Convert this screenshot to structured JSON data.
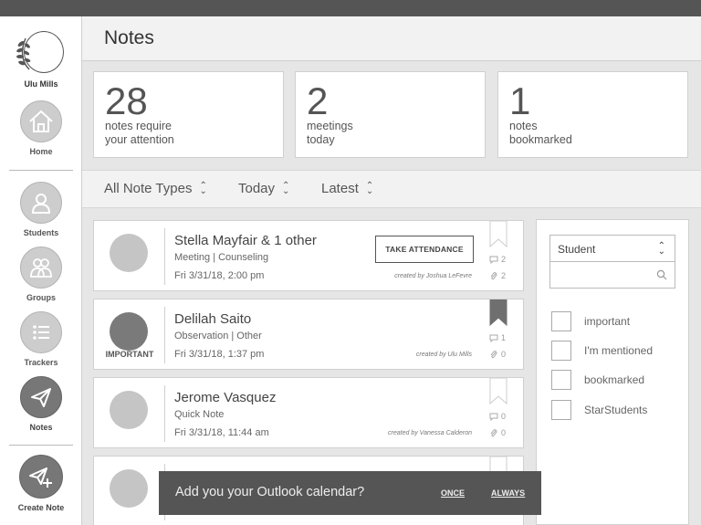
{
  "header": {
    "title": "Notes"
  },
  "sidebar": {
    "brand": "Ulu Mills",
    "items": [
      {
        "label": "Home"
      },
      {
        "label": "Students"
      },
      {
        "label": "Groups"
      },
      {
        "label": "Trackers"
      },
      {
        "label": "Notes"
      },
      {
        "label": "Create Note"
      }
    ]
  },
  "stats": [
    {
      "number": "28",
      "line1": "notes require",
      "line2": "your attention"
    },
    {
      "number": "2",
      "line1": "meetings",
      "line2": "today"
    },
    {
      "number": "1",
      "line1": "notes",
      "line2": "bookmarked"
    }
  ],
  "filters": {
    "type": "All Note Types",
    "date": "Today",
    "sort": "Latest"
  },
  "notes": [
    {
      "name": "Stella Mayfair & 1 other",
      "type": "Meeting | Counseling",
      "date": "Fri 3/31/18, 2:00 pm",
      "creator": "created by Joshua LeFevre",
      "action": "TAKE ATTENDANCE",
      "comments": "2",
      "attachments": "2",
      "bookmarked": false,
      "badge": ""
    },
    {
      "name": "Delilah Saito",
      "type": "Observation | Other",
      "date": "Fri 3/31/18, 1:37 pm",
      "creator": "created by Ulu Mills",
      "comments": "1",
      "attachments": "0",
      "bookmarked": true,
      "badge": "IMPORTANT"
    },
    {
      "name": "Jerome Vasquez",
      "type": "Quick Note",
      "date": "Fri 3/31/18, 11:44 am",
      "creator": "created by Vanessa Calderon",
      "comments": "0",
      "attachments": "0",
      "bookmarked": false,
      "badge": ""
    }
  ],
  "panel": {
    "select": "Student",
    "search_placeholder": "",
    "checkboxes": [
      "important",
      "I'm mentioned",
      "bookmarked",
      "StarStudents"
    ]
  },
  "toast": {
    "message": "Add you your Outlook calendar?",
    "once": "ONCE",
    "always": "ALWAYS"
  },
  "colors": {
    "accent": "#555555",
    "background": "#e6e6e6",
    "avatar": "#c5c5c5"
  }
}
